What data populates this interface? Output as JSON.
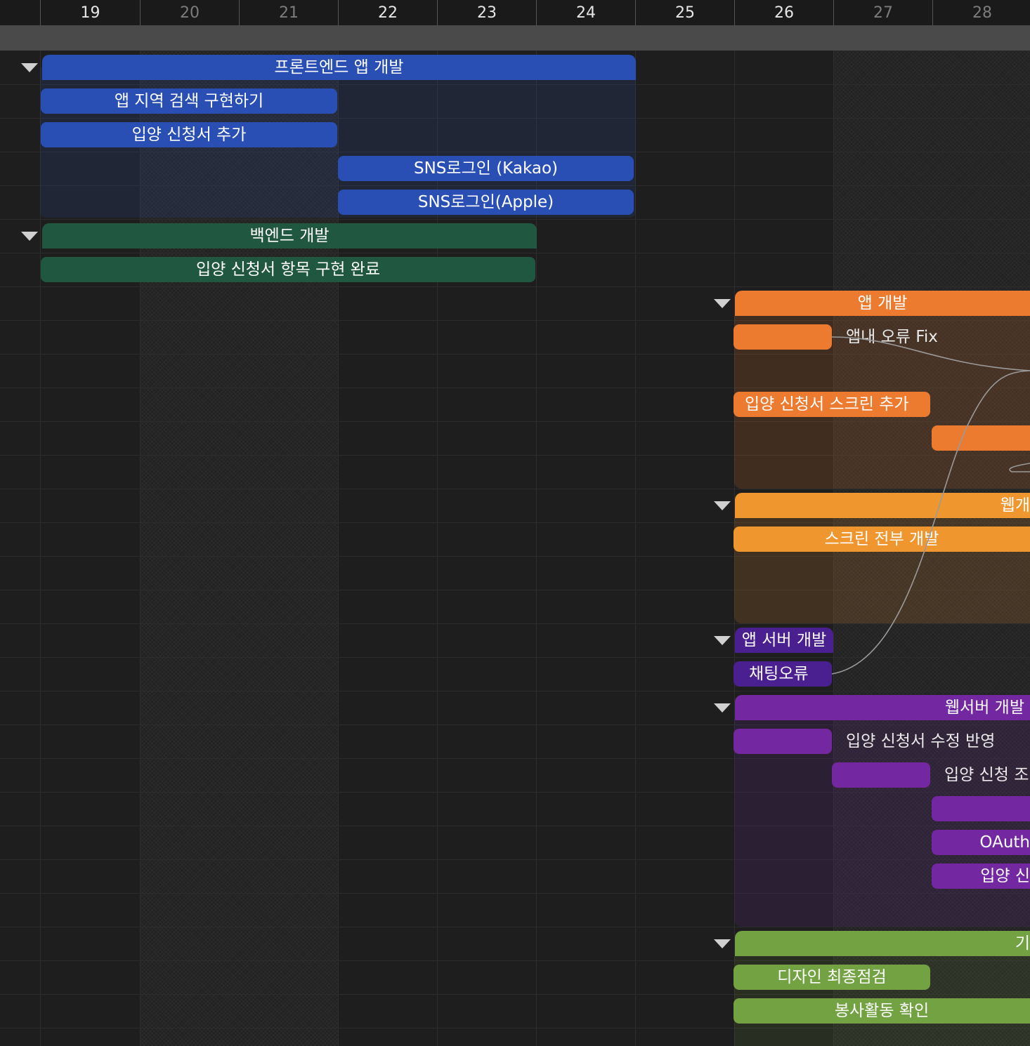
{
  "header": {
    "days": [
      {
        "label": "19",
        "weekend": false
      },
      {
        "label": "20",
        "weekend": true
      },
      {
        "label": "21",
        "weekend": true
      },
      {
        "label": "22",
        "weekend": false
      },
      {
        "label": "23",
        "weekend": false
      },
      {
        "label": "24",
        "weekend": false
      },
      {
        "label": "25",
        "weekend": false
      },
      {
        "label": "26",
        "weekend": false
      },
      {
        "label": "27",
        "weekend": true
      },
      {
        "label": "28",
        "weekend": true
      }
    ]
  },
  "groups": {
    "frontend_app": {
      "label": "프론트엔드 앱 개발",
      "color": "#2a4fb4"
    },
    "backend": {
      "label": "백엔드 개발",
      "color": "#1f5740"
    },
    "app_dev": {
      "label": "앱 개발",
      "color": "#ec7a2f"
    },
    "web_dev": {
      "label": "웹개",
      "color": "#f0962f"
    },
    "app_server": {
      "label": "앱 서버 개발",
      "color": "#4a1f8f"
    },
    "web_server": {
      "label": "웹서버 개발",
      "color": "#7327a0"
    },
    "green_group": {
      "label": "기",
      "color": "#72a242"
    }
  },
  "tasks": {
    "t1": "앱 지역 검색 구현하기",
    "t2": "입양 신청서 추가",
    "t3": "SNS로그인 (Kakao)",
    "t4": "SNS로그인(Apple)",
    "t5": "입양 신청서 항목 구현 완료",
    "t6": "앱내 오류 Fix",
    "t7": "입양 신청서 스크린 추가",
    "t8": "",
    "t9": "스크린 전부 개발",
    "t10": "채팅오류",
    "t11": "입양 신청서 수정 반영",
    "t12": "입양 신청 조",
    "t13": "",
    "t14": "OAuth",
    "t15": "입양 신",
    "t16": "디자인 최종점검",
    "t17": "봉사활동 확인"
  }
}
